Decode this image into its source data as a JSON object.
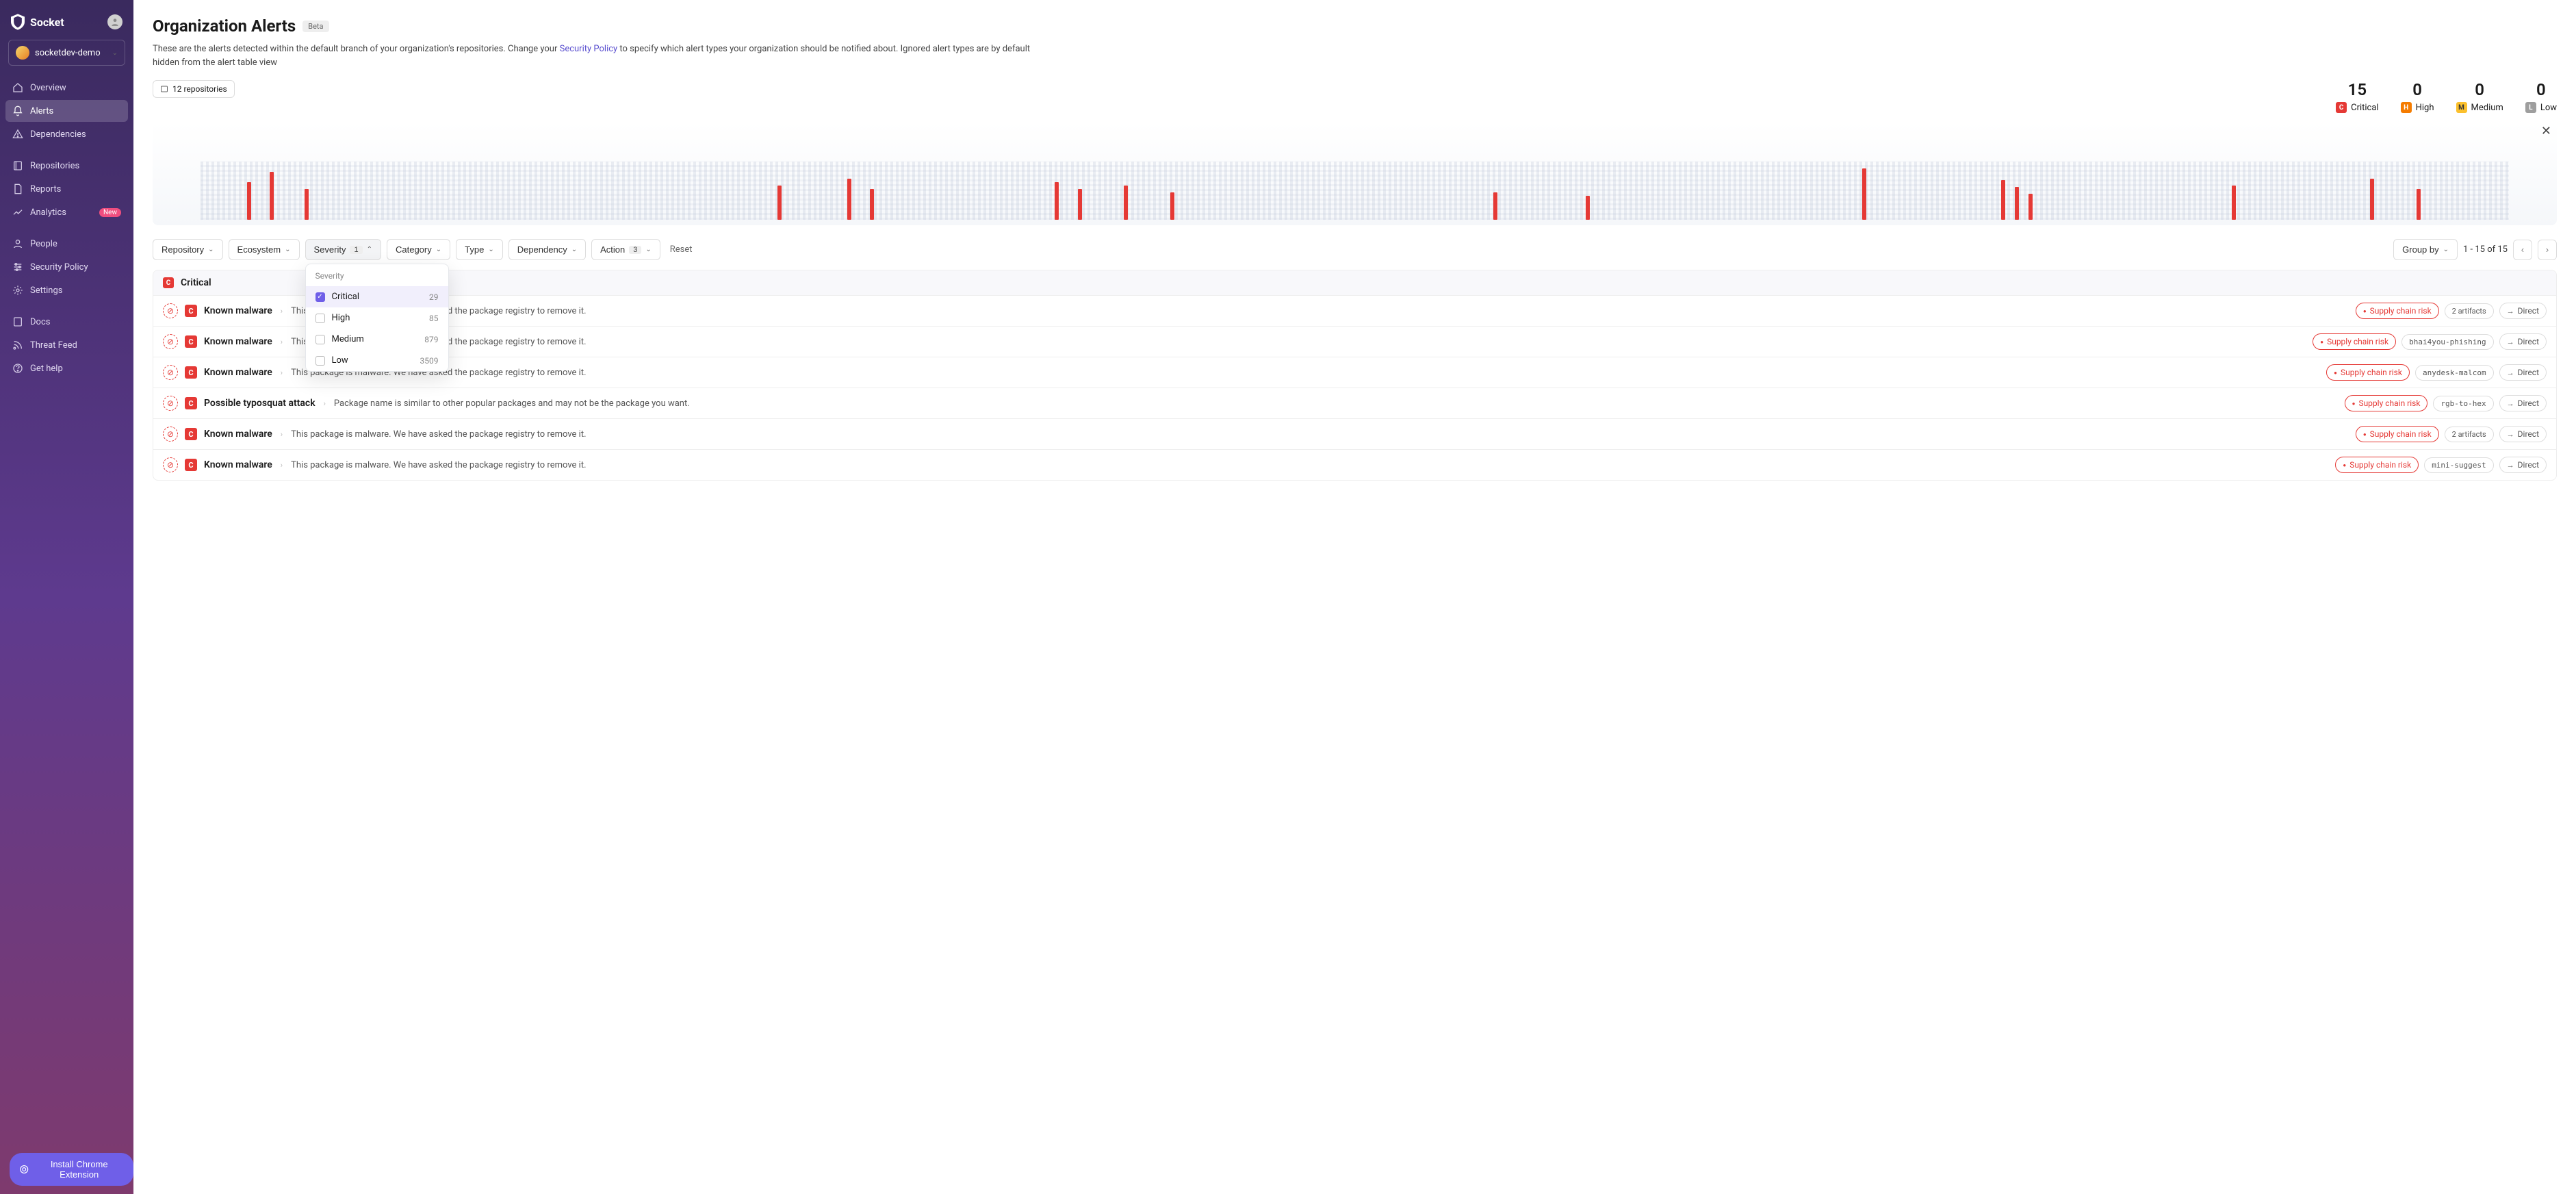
{
  "brand": "Socket",
  "org": "socketdev-demo",
  "nav": [
    {
      "label": "Overview",
      "icon": "home"
    },
    {
      "label": "Alerts",
      "icon": "bell",
      "active": true
    },
    {
      "label": "Dependencies",
      "icon": "alert-triangle"
    },
    {
      "label": "Repositories",
      "icon": "repo"
    },
    {
      "label": "Reports",
      "icon": "file"
    },
    {
      "label": "Analytics",
      "icon": "chart",
      "badge": "New"
    },
    {
      "label": "People",
      "icon": "user"
    },
    {
      "label": "Security Policy",
      "icon": "sliders"
    },
    {
      "label": "Settings",
      "icon": "gear"
    },
    {
      "label": "Docs",
      "icon": "book"
    },
    {
      "label": "Threat Feed",
      "icon": "rss"
    },
    {
      "label": "Get help",
      "icon": "help"
    }
  ],
  "chrome_ext_label": "Install Chrome Extension",
  "page": {
    "title": "Organization Alerts",
    "beta": "Beta",
    "subtitle_pre": "These are the alerts detected within the default branch of your organization's repositories. Change your ",
    "subtitle_link": "Security Policy",
    "subtitle_post": " to specify which alert types your organization should be notified about. Ignored alert types are by default hidden from the alert table view",
    "repos_chip": "12 repositories"
  },
  "sev_counts": {
    "critical": {
      "n": "15",
      "label": "Critical",
      "letter": "C"
    },
    "high": {
      "n": "0",
      "label": "High",
      "letter": "H"
    },
    "medium": {
      "n": "0",
      "label": "Medium",
      "letter": "M"
    },
    "low": {
      "n": "0",
      "label": "Low",
      "letter": "L"
    }
  },
  "filters": {
    "repository": "Repository",
    "ecosystem": "Ecosystem",
    "severity": "Severity",
    "severity_n": "1",
    "category": "Category",
    "type": "Type",
    "dependency": "Dependency",
    "action": "Action",
    "action_n": "3",
    "reset": "Reset",
    "group_by": "Group by",
    "pager": "1 - 15 of 15"
  },
  "dropdown": {
    "title": "Severity",
    "items": [
      {
        "label": "Critical",
        "count": "29",
        "checked": true
      },
      {
        "label": "High",
        "count": "85"
      },
      {
        "label": "Medium",
        "count": "879"
      },
      {
        "label": "Low",
        "count": "3509"
      }
    ]
  },
  "group_label": "Critical",
  "rows": [
    {
      "title": "Known malware",
      "desc": "This package is malware. We have asked the package registry to remove it.",
      "risk": "Supply chain risk",
      "chip": "2 artifacts",
      "direct": "Direct"
    },
    {
      "title": "Known malware",
      "desc": "This package is malware. We have asked the package registry to remove it.",
      "risk": "Supply chain risk",
      "chip": "bhai4you-phishing",
      "mono": true,
      "direct": "Direct"
    },
    {
      "title": "Known malware",
      "desc": "This package is malware. We have asked the package registry to remove it.",
      "risk": "Supply chain risk",
      "chip": "anydesk-malcom",
      "mono": true,
      "direct": "Direct"
    },
    {
      "title": "Possible typosquat attack",
      "desc": "Package name is similar to other popular packages and may not be the package you want.",
      "risk": "Supply chain risk",
      "chip": "rgb-to-hex",
      "mono": true,
      "direct": "Direct"
    },
    {
      "title": "Known malware",
      "desc": "This package is malware. We have asked the package registry to remove it.",
      "risk": "Supply chain risk",
      "chip": "2 artifacts",
      "direct": "Direct"
    },
    {
      "title": "Known malware",
      "desc": "This package is malware. We have asked the package registry to remove it.",
      "risk": "Supply chain risk",
      "chip": "mini-suggest",
      "mono": true,
      "direct": "Direct"
    }
  ],
  "chart_data": {
    "type": "bar",
    "note": "decorative 3D strip of alert density; red bars mark critical alerts along a timeline",
    "bars": [
      {
        "x": 2,
        "h": 55
      },
      {
        "x": 3,
        "h": 70
      },
      {
        "x": 4.5,
        "h": 45
      },
      {
        "x": 25,
        "h": 50
      },
      {
        "x": 28,
        "h": 60
      },
      {
        "x": 29,
        "h": 45
      },
      {
        "x": 37,
        "h": 55
      },
      {
        "x": 38,
        "h": 45
      },
      {
        "x": 40,
        "h": 50
      },
      {
        "x": 42,
        "h": 40
      },
      {
        "x": 56,
        "h": 40
      },
      {
        "x": 60,
        "h": 35
      },
      {
        "x": 72,
        "h": 75
      },
      {
        "x": 78,
        "h": 58
      },
      {
        "x": 78.6,
        "h": 48
      },
      {
        "x": 79.2,
        "h": 38
      },
      {
        "x": 88,
        "h": 50
      },
      {
        "x": 94,
        "h": 60
      },
      {
        "x": 96,
        "h": 45
      }
    ]
  }
}
